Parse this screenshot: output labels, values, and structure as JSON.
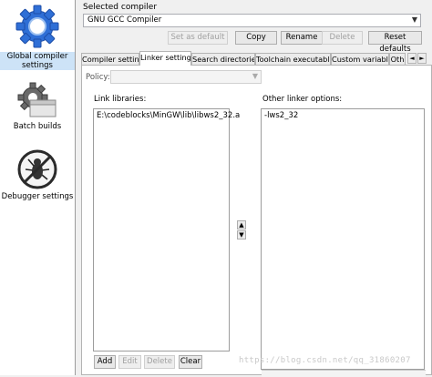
{
  "sidebar": {
    "items": [
      {
        "label_line1": "Global compiler",
        "label_line2": "settings",
        "icon": "gear-icon",
        "selected": true
      },
      {
        "label": "Batch builds",
        "icon": "batch-gear-icon"
      },
      {
        "label": "Debugger settings",
        "icon": "bug-icon"
      }
    ]
  },
  "compiler": {
    "label": "Selected compiler",
    "value": "GNU GCC Compiler"
  },
  "buttons": {
    "set_default": "Set as default",
    "copy": "Copy",
    "rename": "Rename",
    "delete": "Delete",
    "reset": "Reset defaults"
  },
  "tabs": [
    {
      "label": "Compiler settings"
    },
    {
      "label": "Linker settings",
      "active": true
    },
    {
      "label": "Search directories"
    },
    {
      "label": "Toolchain executables"
    },
    {
      "label": "Custom variables"
    },
    {
      "label": "Oth"
    }
  ],
  "tab_nav": {
    "prev": "◄",
    "next": "►"
  },
  "policy": {
    "label": "Policy:",
    "value": ""
  },
  "link_libraries": {
    "title": "Link libraries:",
    "items": [
      "E:\\codeblocks\\MinGW\\lib\\libws2_32.a"
    ],
    "buttons": {
      "add": "Add",
      "edit": "Edit",
      "delete": "Delete",
      "clear": "Clear"
    }
  },
  "move_buttons": {
    "up": "▲",
    "down": "▼"
  },
  "other_options": {
    "title": "Other linker options:",
    "text": "-lws2_32"
  },
  "watermark": "https://blog.csdn.net/qq_31860207"
}
